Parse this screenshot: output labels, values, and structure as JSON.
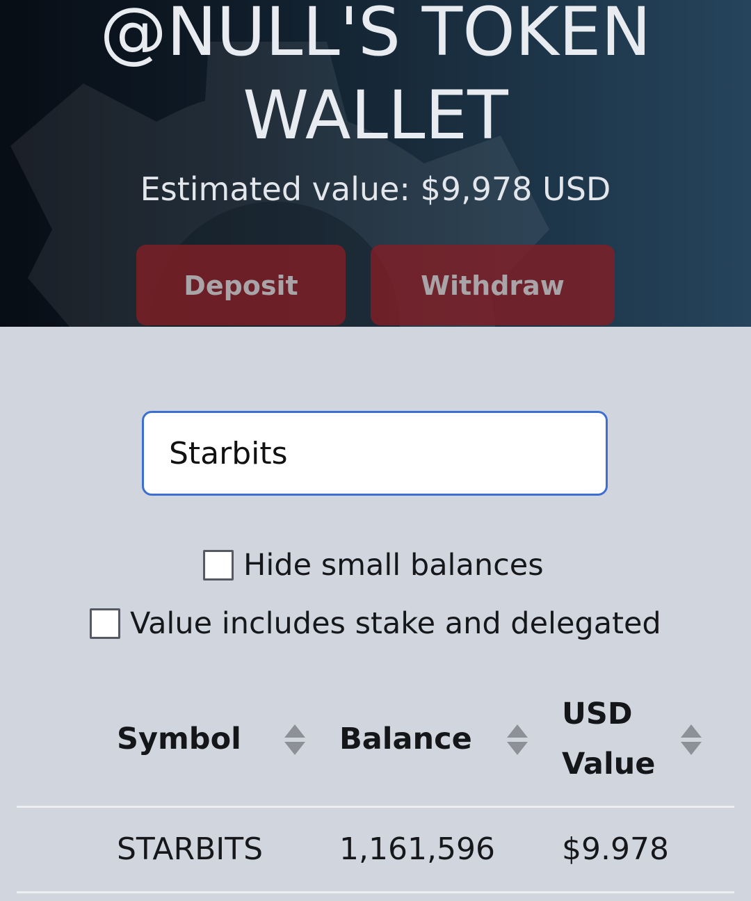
{
  "hero": {
    "title_line_1": "@NULL'S TOKEN",
    "title_line_2": "WALLET",
    "estimated_value": "Estimated value: $9,978 USD",
    "deposit_label": "Deposit",
    "withdraw_label": "Withdraw",
    "background_icon": "gear-icon"
  },
  "search": {
    "value": "Starbits"
  },
  "options": {
    "hide_small_balances": {
      "label": "Hide small balances",
      "checked": false
    },
    "include_stake": {
      "label": "Value includes stake and delegated",
      "checked": false
    }
  },
  "table": {
    "headers": [
      {
        "label": "Symbol",
        "sort_icon": "sort-icon"
      },
      {
        "label": "Balance",
        "sort_icon": "sort-icon"
      },
      {
        "label_line_1": "USD",
        "label_line_2": "Value",
        "sort_icon": "sort-icon"
      }
    ],
    "rows": [
      {
        "symbol": "STARBITS",
        "balance": "1,161,596",
        "usd_value": "$9.978"
      }
    ]
  },
  "colors": {
    "button_bg": "#801e26",
    "search_border": "#3d6fd1",
    "page_bg": "#d1d5de"
  }
}
